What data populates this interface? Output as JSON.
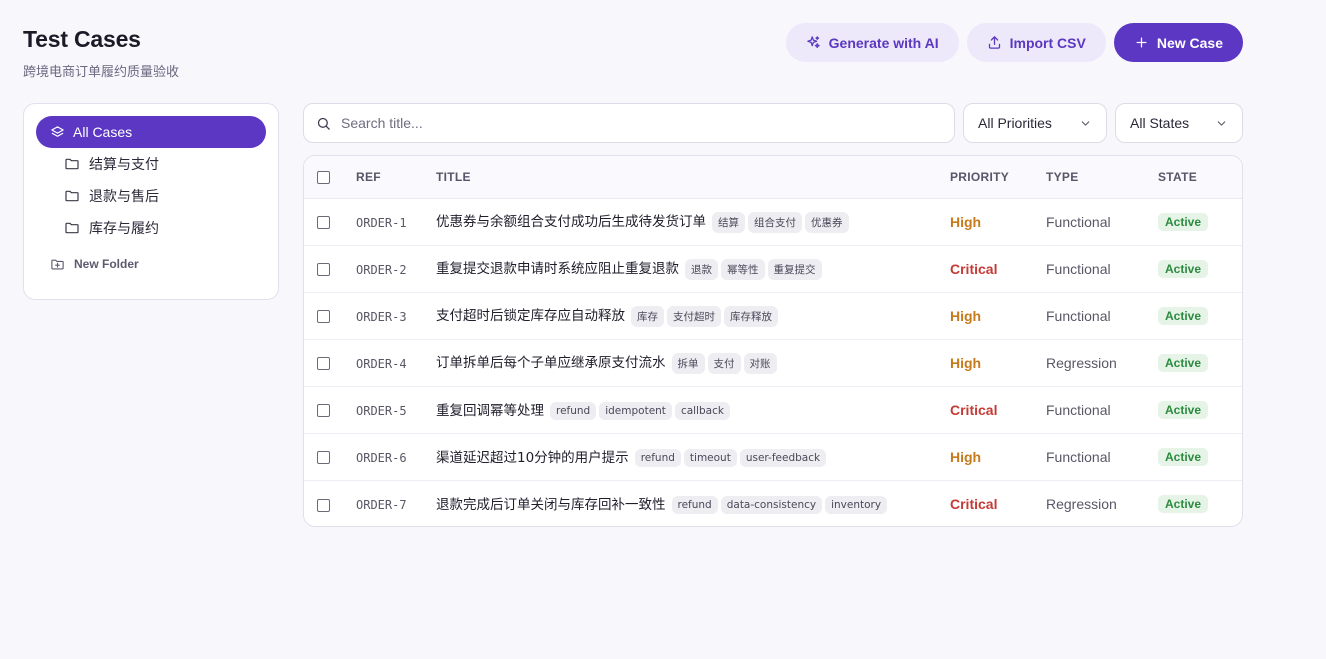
{
  "header": {
    "title": "Test Cases",
    "subtitle": "跨境电商订单履约质量验收"
  },
  "actions": {
    "generate_label": "Generate with AI",
    "import_label": "Import CSV",
    "new_label": "New Case"
  },
  "sidebar": {
    "all_label": "All Cases",
    "folders": [
      "结算与支付",
      "退款与售后",
      "库存与履约"
    ],
    "new_folder_label": "New Folder"
  },
  "filters": {
    "search_placeholder": "Search title...",
    "priority_value": "All Priorities",
    "state_value": "All States"
  },
  "table": {
    "headers": {
      "ref": "REF",
      "title": "TITLE",
      "priority": "PRIORITY",
      "type": "TYPE",
      "state": "STATE"
    },
    "rows": [
      {
        "ref": "ORDER-1",
        "title": "优惠券与余额组合支付成功后生成待发货订单",
        "tags": [
          "结算",
          "组合支付",
          "优惠券"
        ],
        "priority": "High",
        "type": "Functional",
        "state": "Active"
      },
      {
        "ref": "ORDER-2",
        "title": "重复提交退款申请时系统应阻止重复退款",
        "tags": [
          "退款",
          "幂等性",
          "重复提交"
        ],
        "priority": "Critical",
        "type": "Functional",
        "state": "Active"
      },
      {
        "ref": "ORDER-3",
        "title": "支付超时后锁定库存应自动释放",
        "tags": [
          "库存",
          "支付超时",
          "库存释放"
        ],
        "priority": "High",
        "type": "Functional",
        "state": "Active"
      },
      {
        "ref": "ORDER-4",
        "title": "订单拆单后每个子单应继承原支付流水",
        "tags": [
          "拆单",
          "支付",
          "对账"
        ],
        "priority": "High",
        "type": "Regression",
        "state": "Active"
      },
      {
        "ref": "ORDER-5",
        "title": "重复回调幂等处理",
        "tags": [
          "refund",
          "idempotent",
          "callback"
        ],
        "priority": "Critical",
        "type": "Functional",
        "state": "Active"
      },
      {
        "ref": "ORDER-6",
        "title": "渠道延迟超过10分钟的用户提示",
        "tags": [
          "refund",
          "timeout",
          "user-feedback"
        ],
        "priority": "High",
        "type": "Functional",
        "state": "Active"
      },
      {
        "ref": "ORDER-7",
        "title": "退款完成后订单关闭与库存回补一致性",
        "tags": [
          "refund",
          "data-consistency",
          "inventory"
        ],
        "priority": "Critical",
        "type": "Regression",
        "state": "Active"
      }
    ]
  },
  "colors": {
    "accent": "#5b37c3",
    "high": "#c67a1c",
    "critical": "#c43a35",
    "active": "#2c8a3f"
  }
}
